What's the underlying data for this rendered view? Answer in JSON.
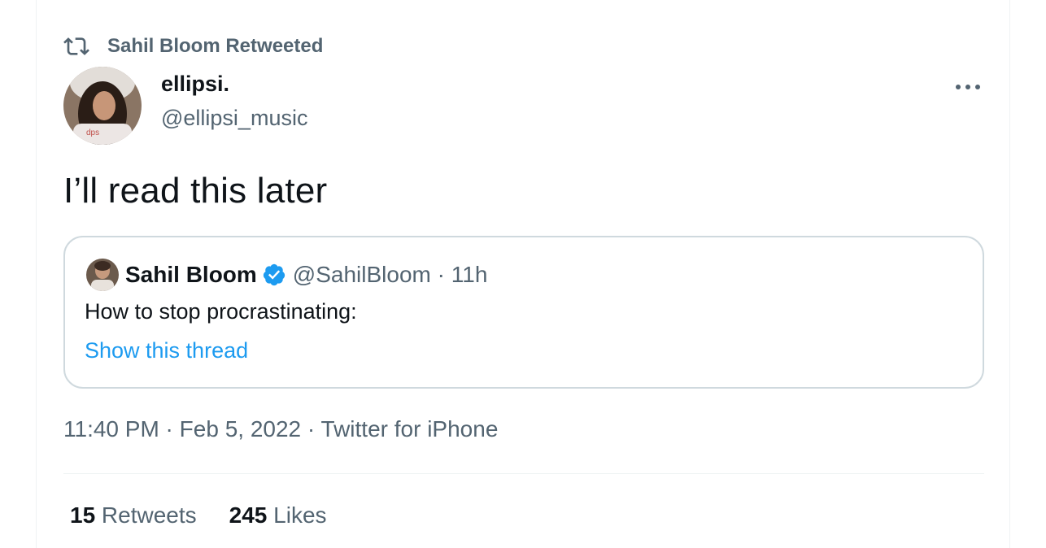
{
  "retweet_bar": {
    "icon": "retweet-icon",
    "label": "Sahil Bloom Retweeted"
  },
  "tweet": {
    "author_name": "ellipsi.",
    "author_handle": "@ellipsi_music",
    "text": "I’ll read this later",
    "more_icon": "more-dots-icon"
  },
  "quote": {
    "author_name": "Sahil Bloom",
    "verified_icon": "verified-badge-icon",
    "author_handle": "@SahilBloom",
    "separator": " · ",
    "time": "11h",
    "text": "How to stop procrastinating:",
    "link": "Show this thread"
  },
  "meta": {
    "time": "11:40 PM",
    "sep1": " · ",
    "date": "Feb 5, 2022",
    "sep2": " · ",
    "source": "Twitter for iPhone"
  },
  "stats": {
    "retweets_count": "15",
    "retweets_label": " Retweets",
    "likes_count": "245",
    "likes_label": " Likes"
  },
  "colors": {
    "accent": "#1d9bf0",
    "muted": "#536471",
    "text": "#0f1419",
    "border": "#cfd9de"
  }
}
